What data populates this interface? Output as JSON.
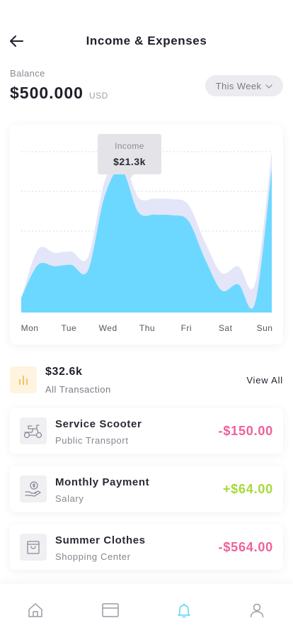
{
  "header": {
    "title": "Income & Expenses"
  },
  "balance": {
    "label": "Balance",
    "value": "$500.000",
    "currency": "USD"
  },
  "period": {
    "selected": "This Week"
  },
  "chart_data": {
    "type": "area",
    "categories": [
      "Mon",
      "Tue",
      "Wed",
      "Thu",
      "Fri",
      "Sat",
      "Sun"
    ],
    "tooltip": {
      "label": "Income",
      "value": "$21.3k"
    },
    "series": [
      {
        "name": "Income",
        "values": [
          2.2,
          7.1,
          6.9,
          7.1,
          6.3,
          17.4,
          21.3,
          15.0,
          14.6,
          14.5,
          13.7,
          8.0,
          3.3,
          4.2,
          1.4,
          21.5
        ]
      },
      {
        "values": [
          2.2,
          9.4,
          8.9,
          9.1,
          8.3,
          19.6,
          23.0,
          17.2,
          17.0,
          16.9,
          16.1,
          10.5,
          5.9,
          6.9,
          4.3,
          24.0
        ]
      }
    ],
    "ylim": [
      0,
      28
    ],
    "grid": true,
    "colors": {
      "front": "#6dd8ff",
      "back": "#e3e6f8",
      "marker": "#5ad2f4"
    }
  },
  "summary": {
    "amount": "$32.6k",
    "label": "All Transaction",
    "view_all": "View All"
  },
  "transactions": [
    {
      "title": "Service Scooter",
      "subtitle": "Public Transport",
      "amount": "-$150.00",
      "color": "#f0609a",
      "icon": "scooter-icon"
    },
    {
      "title": "Monthly Payment",
      "subtitle": "Salary",
      "amount": "+$64.00",
      "color": "#a6d93a",
      "icon": "salary-icon"
    },
    {
      "title": "Summer Clothes",
      "subtitle": "Shopping Center",
      "amount": "-$564.00",
      "color": "#f0609a",
      "icon": "shopping-bag-icon"
    }
  ],
  "nav": {
    "items": [
      {
        "icon": "home-icon",
        "active": false
      },
      {
        "icon": "card-icon",
        "active": false
      },
      {
        "icon": "bell-icon",
        "active": true
      },
      {
        "icon": "user-icon",
        "active": false
      }
    ],
    "active_color": "#5ad2f4"
  }
}
